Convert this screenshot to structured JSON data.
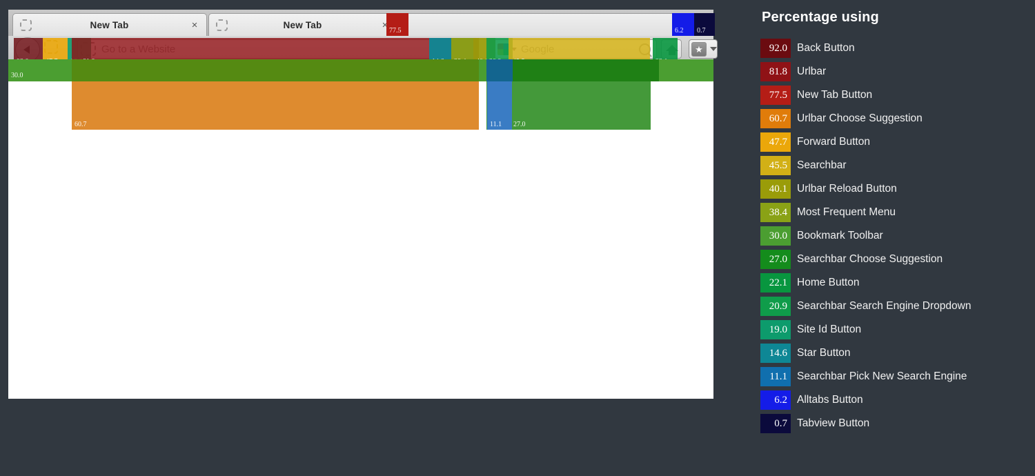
{
  "legend": {
    "title": "Percentage using",
    "items": [
      {
        "value": "92.0",
        "label": "Back Button",
        "color": "#6b0b10"
      },
      {
        "value": "81.8",
        "label": "Urlbar",
        "color": "#8f1216"
      },
      {
        "value": "77.5",
        "label": "New Tab Button",
        "color": "#b41d16"
      },
      {
        "value": "60.7",
        "label": "Urlbar Choose Suggestion",
        "color": "#e07c0a"
      },
      {
        "value": "47.7",
        "label": "Forward Button",
        "color": "#eba70a"
      },
      {
        "value": "45.5",
        "label": "Searchbar",
        "color": "#d2b016"
      },
      {
        "value": "40.1",
        "label": "Urlbar Reload Button",
        "color": "#9a9c09"
      },
      {
        "value": "38.4",
        "label": "Most Frequent Menu",
        "color": "#8aa216"
      },
      {
        "value": "30.0",
        "label": "Bookmark Toolbar",
        "color": "#4b9e31"
      },
      {
        "value": "27.0",
        "label": "Searchbar Choose Suggestion",
        "color": "#148c1c"
      },
      {
        "value": "22.1",
        "label": "Home Button",
        "color": "#08963f"
      },
      {
        "value": "20.9",
        "label": "Searchbar Search Engine Dropdown",
        "color": "#0f9c4a"
      },
      {
        "value": "19.0",
        "label": "Site Id Button",
        "color": "#0d9b6c"
      },
      {
        "value": "14.6",
        "label": "Star Button",
        "color": "#0e8795"
      },
      {
        "value": "11.1",
        "label": "Searchbar Pick New Search Engine",
        "color": "#106fae"
      },
      {
        "value": "6.2",
        "label": "Alltabs Button",
        "color": "#141ce8"
      },
      {
        "value": "0.7",
        "label": "Tabview Button",
        "color": "#0b0a3c"
      }
    ]
  },
  "browser": {
    "tabs": [
      {
        "title": "New Tab",
        "close": "×"
      },
      {
        "title": "New Tab",
        "close": "×"
      }
    ],
    "urlbar_placeholder": "Go to a Website",
    "searchbar_placeholder": "Google",
    "star_glyph": "★"
  },
  "overlays": {
    "back_button": {
      "value": "92.0"
    },
    "forward_button": {
      "value": "47.7"
    },
    "site_id_button": {
      "value": "19.0"
    },
    "urlbar": {
      "value": "81.8"
    },
    "star_button": {
      "value": "14.6"
    },
    "most_frequent_menu": {
      "value": "38.4"
    },
    "urlbar_reload": {
      "value": "40.1"
    },
    "search_engine_dd": {
      "value": "20.9"
    },
    "searchbar": {
      "value": "45.5"
    },
    "home_button": {
      "value": "22.1"
    },
    "new_tab_button": {
      "value": "77.5"
    },
    "alltabs_button": {
      "value": "6.2"
    },
    "tabview_button": {
      "value": "0.7"
    },
    "bookmark_toolbar": {
      "value": "30.0"
    },
    "urlbar_suggestion": {
      "value": "60.7"
    },
    "searchbar_pick_engine": {
      "value": "11.1"
    },
    "searchbar_suggestion": {
      "value": "27.0"
    }
  },
  "chart_data": {
    "type": "heatmap",
    "title": "Percentage using",
    "description": "Firefox UI element usage heatmap overlaid on a browser chrome mockup",
    "unit": "percent",
    "categories": [
      "Back Button",
      "Urlbar",
      "New Tab Button",
      "Urlbar Choose Suggestion",
      "Forward Button",
      "Searchbar",
      "Urlbar Reload Button",
      "Most Frequent Menu",
      "Bookmark Toolbar",
      "Searchbar Choose Suggestion",
      "Home Button",
      "Searchbar Search Engine Dropdown",
      "Site Id Button",
      "Star Button",
      "Searchbar Pick New Search Engine",
      "Alltabs Button",
      "Tabview Button"
    ],
    "values": [
      92.0,
      81.8,
      77.5,
      60.7,
      47.7,
      45.5,
      40.1,
      38.4,
      30.0,
      27.0,
      22.1,
      20.9,
      19.0,
      14.6,
      11.1,
      6.2,
      0.7
    ],
    "colors": [
      "#6b0b10",
      "#8f1216",
      "#b41d16",
      "#e07c0a",
      "#eba70a",
      "#d2b016",
      "#9a9c09",
      "#8aa216",
      "#4b9e31",
      "#148c1c",
      "#08963f",
      "#0f9c4a",
      "#0d9b6c",
      "#0e8795",
      "#106fae",
      "#141ce8",
      "#0b0a3c"
    ],
    "ylim": [
      0,
      100
    ],
    "legend_position": "right",
    "grid": false
  }
}
